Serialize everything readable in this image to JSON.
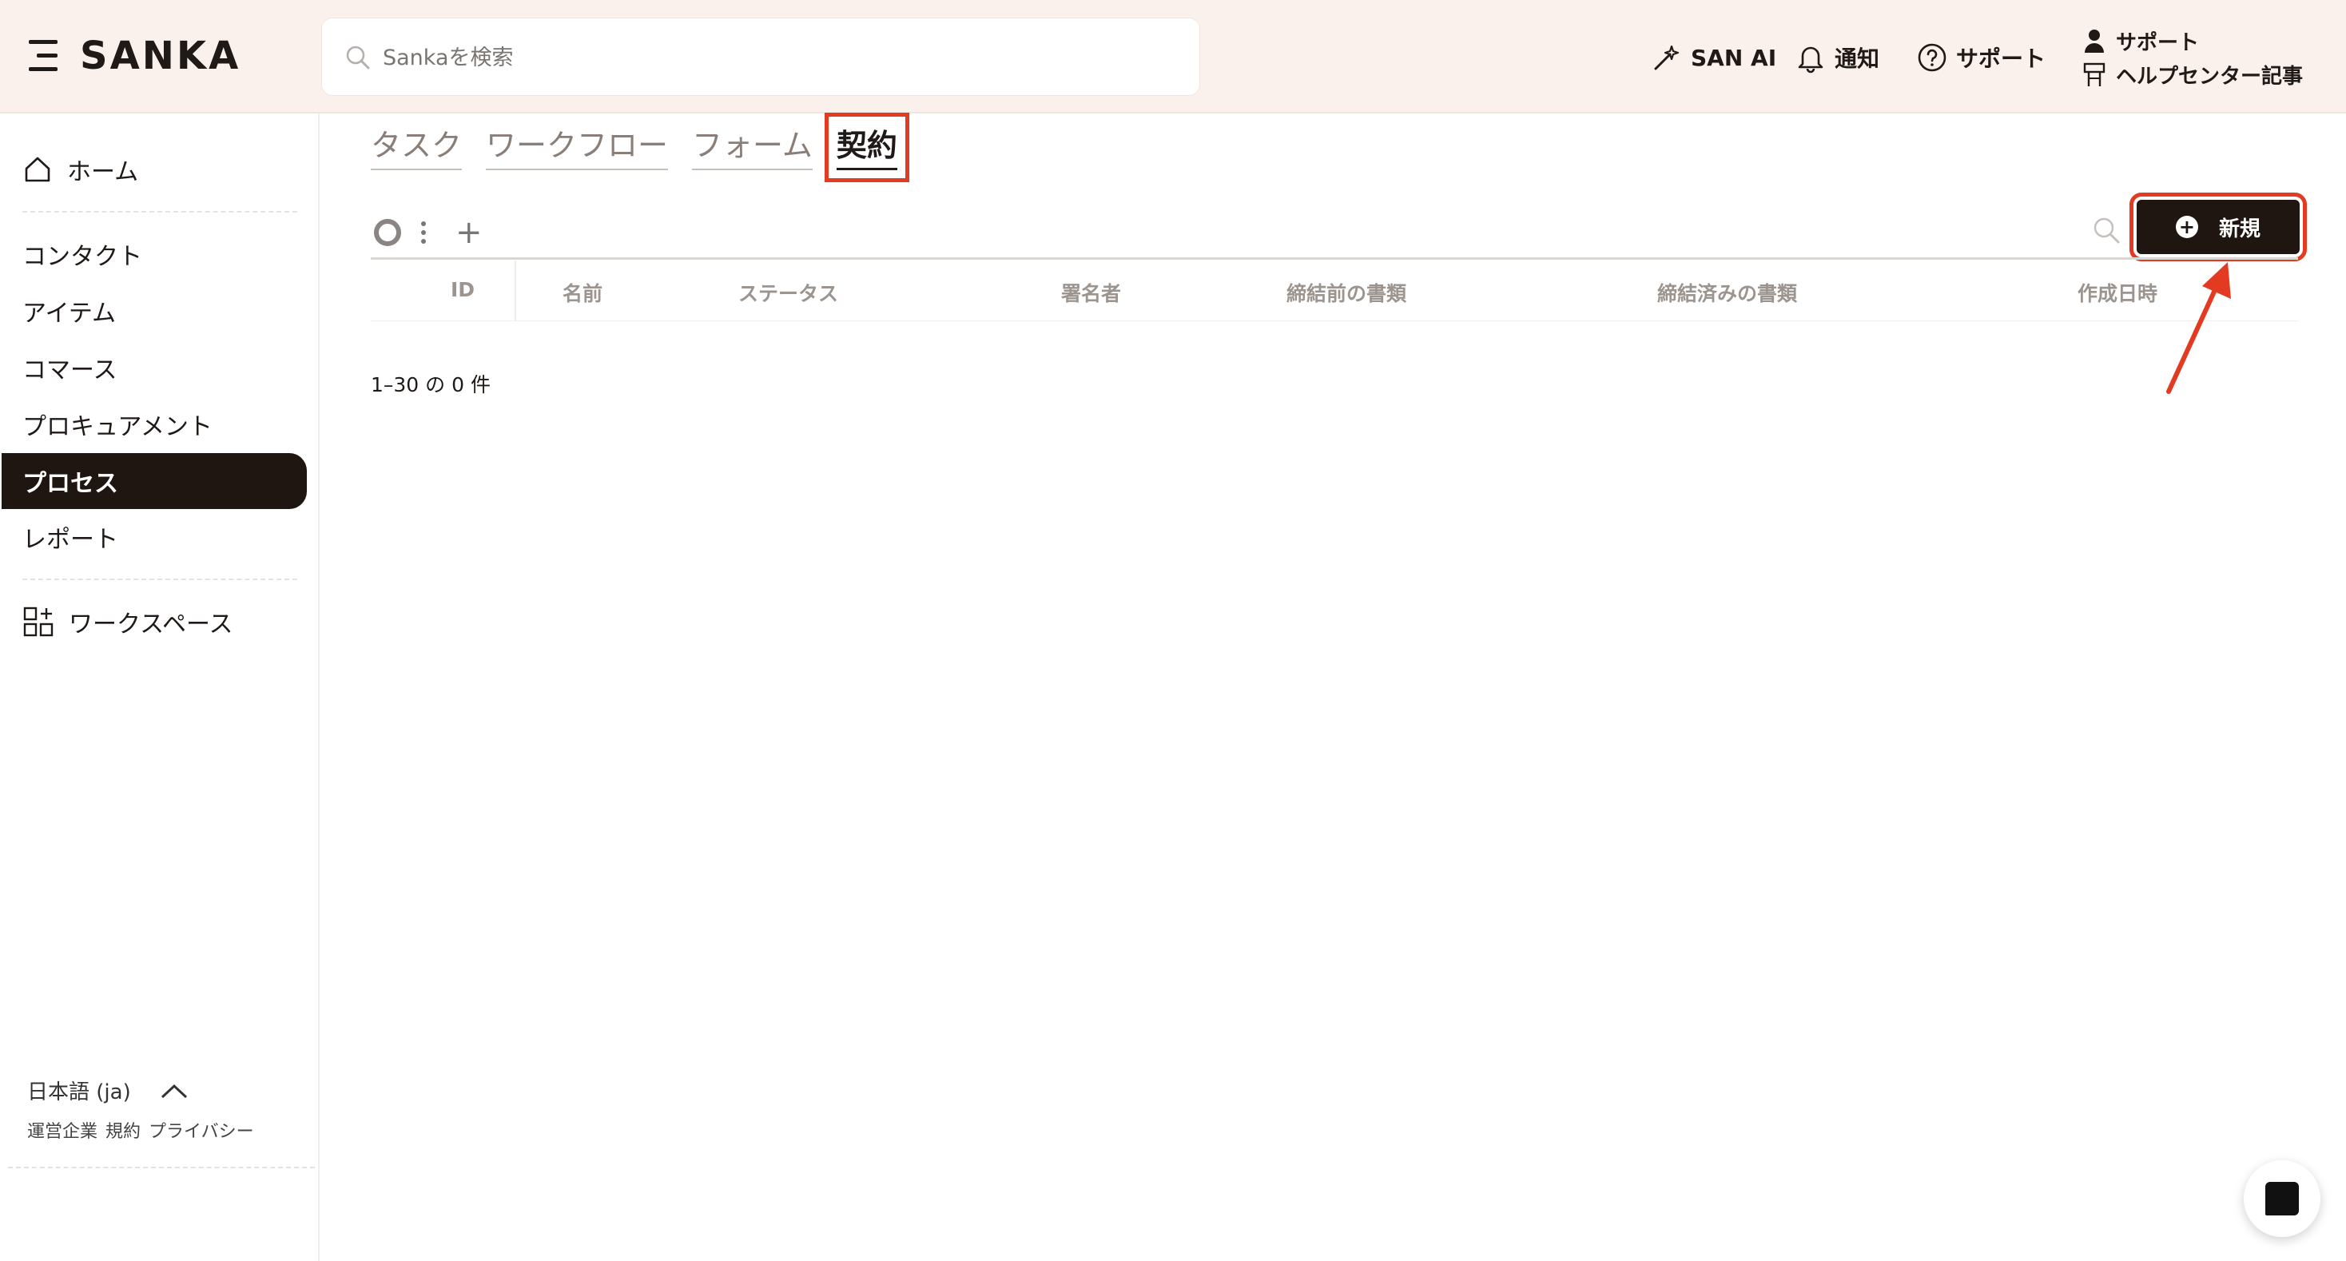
{
  "header": {
    "logo": "SANKA",
    "search_placeholder": "Sankaを検索",
    "san_ai": "SAN AI",
    "notifications": "通知",
    "support": "サポート",
    "support_stack": {
      "line1": "サポート",
      "line2": "ヘルプセンター記事"
    }
  },
  "sidebar": {
    "home": "ホーム",
    "items": [
      "コンタクト",
      "アイテム",
      "コマース",
      "プロキュアメント",
      "プロセス",
      "レポート"
    ],
    "active_item": "プロセス",
    "workspace": "ワークスペース",
    "language": "日本語 (ja)",
    "footer_links": [
      "運営企業",
      "規約",
      "プライバシー"
    ]
  },
  "tabs": [
    "タスク",
    "ワークフロー",
    "フォーム",
    "契約"
  ],
  "active_tab": "契約",
  "toolbar": {
    "new_button": "新規"
  },
  "table": {
    "columns": [
      "ID",
      "名前",
      "ステータス",
      "署名者",
      "締結前の書類",
      "締結済みの書類",
      "作成日時"
    ],
    "rows": []
  },
  "pagination": {
    "count_text": "1–30 の 0 件"
  },
  "colors": {
    "accent": "#e23b21",
    "dark": "#1f1612",
    "header_bg": "#fbf1ec"
  }
}
